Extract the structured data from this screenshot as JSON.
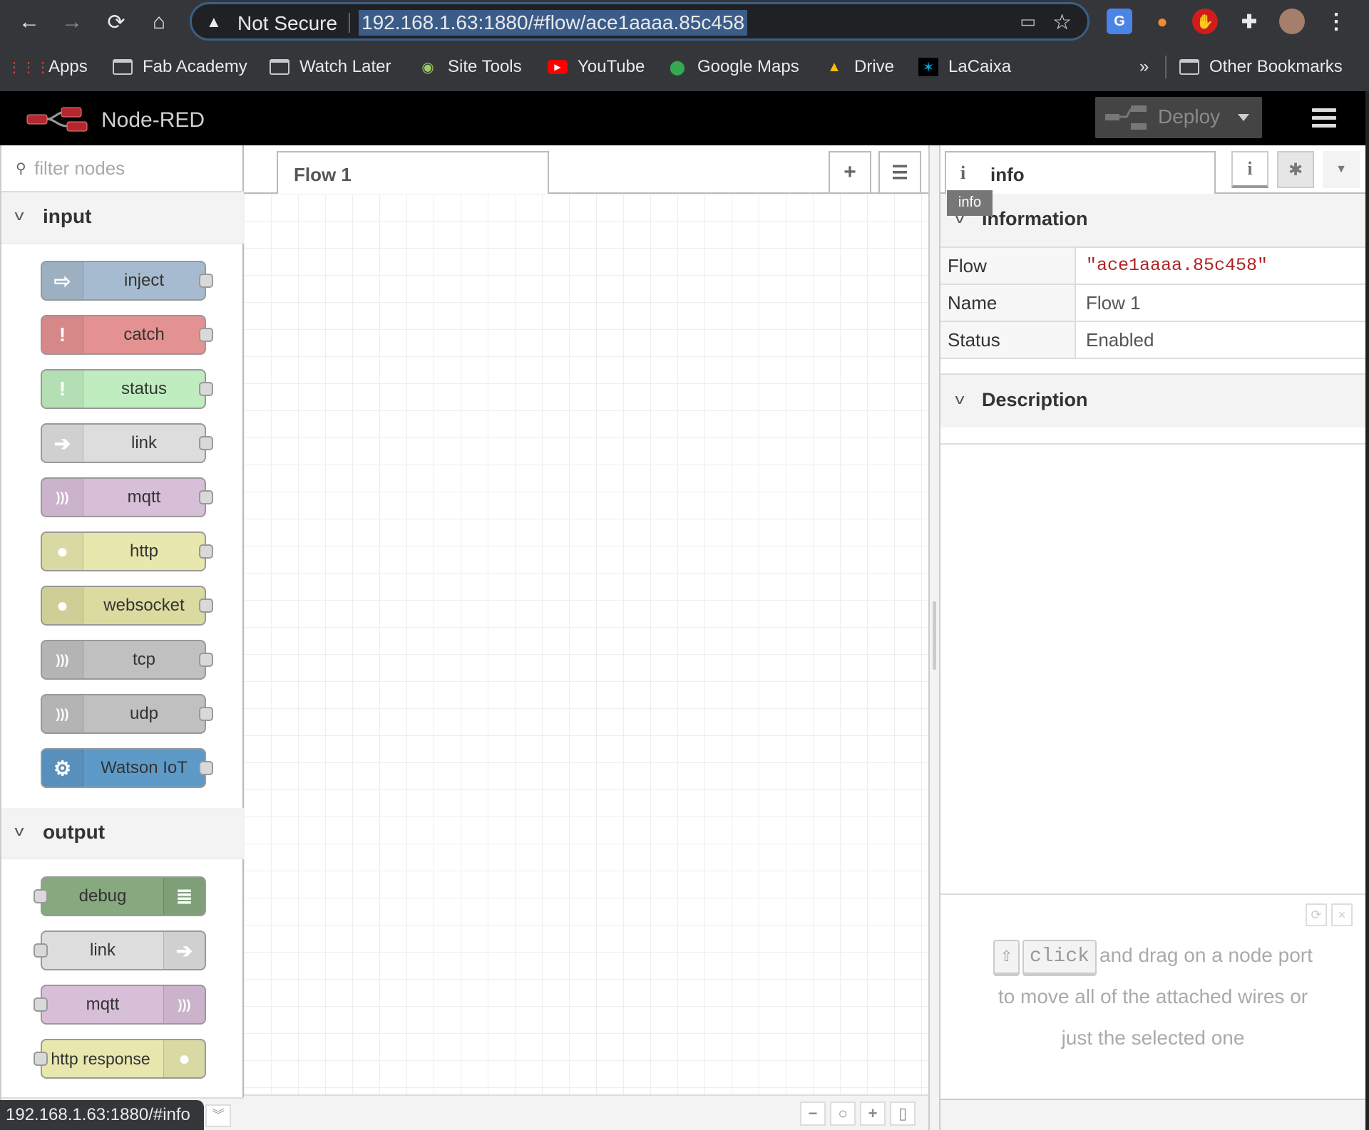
{
  "browser": {
    "nav": {
      "back": "←",
      "forward": "→",
      "reload": "⟳",
      "home": "⌂"
    },
    "security_label": "Not Secure",
    "url": "192.168.1.63:1880/#flow/ace1aaaa.85c458",
    "bookmarks": [
      {
        "label": "Apps",
        "icon": "apps-grid-icon"
      },
      {
        "label": "Fab Academy",
        "icon": "folder-icon"
      },
      {
        "label": "Watch Later",
        "icon": "folder-icon"
      },
      {
        "label": "Site Tools",
        "icon": "site-tools-icon"
      },
      {
        "label": "YouTube",
        "icon": "youtube-icon"
      },
      {
        "label": "Google Maps",
        "icon": "google-maps-icon"
      },
      {
        "label": "Drive",
        "icon": "drive-icon"
      },
      {
        "label": "LaCaixa",
        "icon": "lacaixa-icon"
      }
    ],
    "more_bookmarks": "»",
    "other_bookmarks": "Other Bookmarks",
    "status_bar_url": "192.168.1.63:1880/#info"
  },
  "app": {
    "title": "Node-RED",
    "deploy_label": "Deploy"
  },
  "palette": {
    "filter_placeholder": "filter nodes",
    "categories": [
      {
        "label": "input",
        "nodes": [
          {
            "label": "inject",
            "color": "#a6bbcf",
            "icon": "inject-icon"
          },
          {
            "label": "catch",
            "color": "#e49191",
            "icon": "exclamation-icon"
          },
          {
            "label": "status",
            "color": "#c0edc0",
            "icon": "exclamation-icon"
          },
          {
            "label": "link",
            "color": "#dddddd",
            "icon": "link-in-icon"
          },
          {
            "label": "mqtt",
            "color": "#d8bfd8",
            "icon": "bridge-icon"
          },
          {
            "label": "http",
            "color": "#e7e7ae",
            "icon": "globe-icon"
          },
          {
            "label": "websocket",
            "color": "#dbdba0",
            "icon": "globe-icon"
          },
          {
            "label": "tcp",
            "color": "#c0c0c0",
            "icon": "bridge-dash-icon"
          },
          {
            "label": "udp",
            "color": "#c0c0c0",
            "icon": "bridge-dash-icon"
          },
          {
            "label": "Watson IoT",
            "color": "#5e9ac7",
            "icon": "chip-icon"
          }
        ]
      },
      {
        "label": "output",
        "nodes": [
          {
            "label": "debug",
            "color": "#87a980",
            "icon": "debug-list-icon"
          },
          {
            "label": "link",
            "color": "#dddddd",
            "icon": "link-out-icon"
          },
          {
            "label": "mqtt",
            "color": "#d8bfd8",
            "icon": "bridge-icon"
          },
          {
            "label": "http response",
            "color": "#e7e7ae",
            "icon": "globe-icon"
          }
        ]
      }
    ]
  },
  "workspace": {
    "tabs": [
      {
        "label": "Flow 1",
        "active": true
      }
    ],
    "add_tab": "+",
    "list_tabs": "☰"
  },
  "sidebar": {
    "active_tab": "info",
    "tooltip": "info",
    "information": {
      "title": "Information",
      "rows": [
        {
          "key": "Flow",
          "value": "\"ace1aaaa.85c458\""
        },
        {
          "key": "Name",
          "value": "Flow 1"
        },
        {
          "key": "Status",
          "value": "Enabled"
        }
      ]
    },
    "description_title": "Description",
    "tip": {
      "key_shift": "⇧",
      "key_click": "click",
      "text_1": "and drag on a node port",
      "text_2": "to move all of the attached wires or",
      "text_3": "just the selected one"
    }
  }
}
